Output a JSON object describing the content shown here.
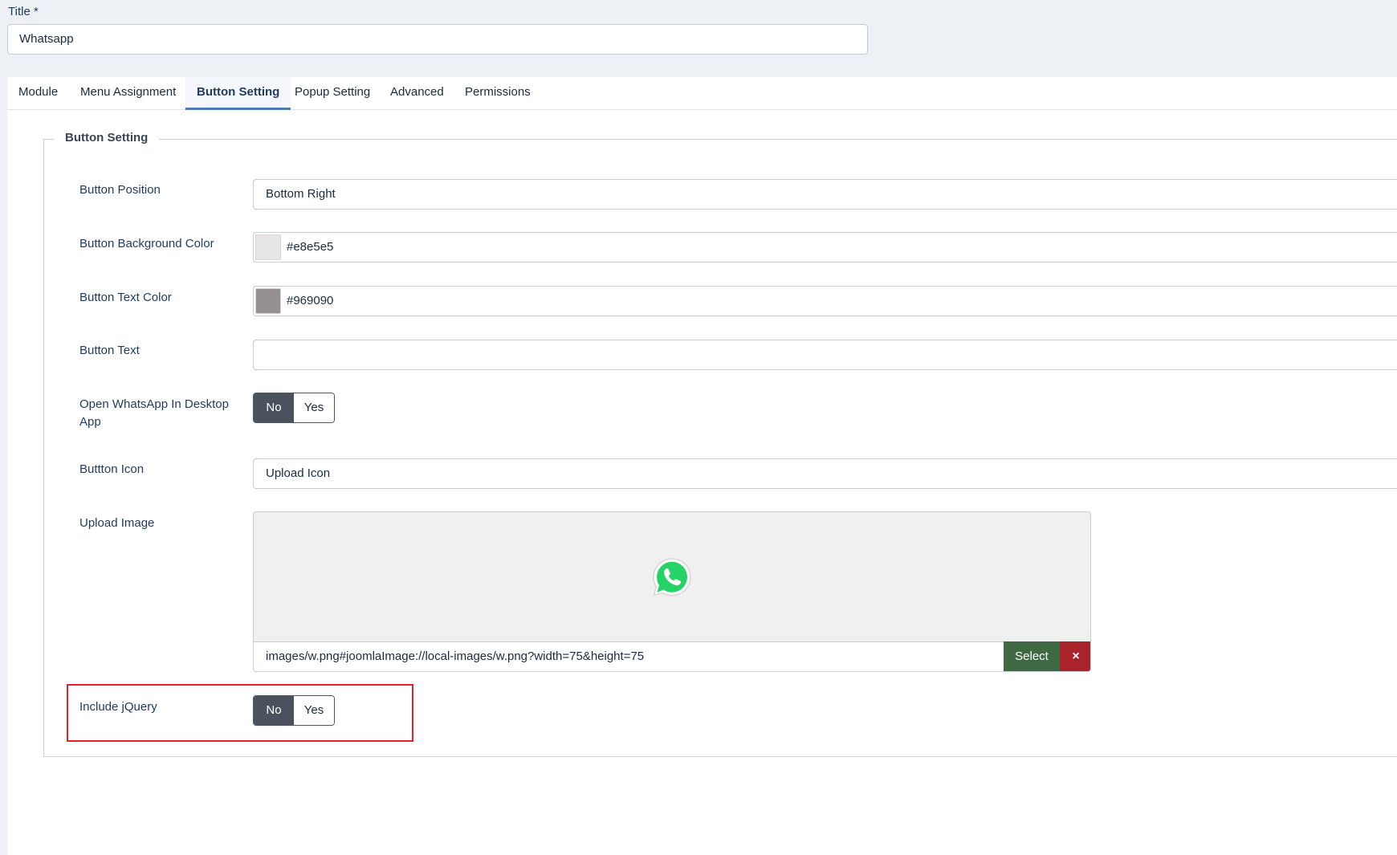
{
  "title_field": {
    "label": "Title *",
    "value": "Whatsapp"
  },
  "tabs": [
    {
      "label": "Module"
    },
    {
      "label": "Menu Assignment"
    },
    {
      "label": "Button Setting",
      "active": true
    },
    {
      "label": "Popup Setting"
    },
    {
      "label": "Advanced"
    },
    {
      "label": "Permissions"
    }
  ],
  "fieldset": {
    "legend": "Button Setting",
    "button_position": {
      "label": "Button Position",
      "value": "Bottom Right"
    },
    "bg_color": {
      "label": "Button Background Color",
      "value": "#e8e5e5",
      "swatch": "#e8e5e5"
    },
    "text_color": {
      "label": "Button Text Color",
      "value": "#969090",
      "swatch": "#969090"
    },
    "button_text": {
      "label": "Button Text",
      "value": ""
    },
    "open_desktop": {
      "label": "Open WhatsApp In Desktop App",
      "no": "No",
      "yes": "Yes",
      "selected": "No"
    },
    "button_icon": {
      "label": "Buttton Icon",
      "value": "Upload Icon"
    },
    "upload_image": {
      "label": "Upload Image",
      "path": "images/w.png#joomlaImage://local-images/w.png?width=75&height=75",
      "select_label": "Select",
      "clear_label": "×",
      "preview_icon": "whatsapp-logo-icon"
    },
    "include_jquery": {
      "label": "Include jQuery",
      "no": "No",
      "yes": "Yes",
      "selected": "No"
    }
  },
  "colors": {
    "active_tab_underline": "#4a7ab8",
    "toggle_on": "#4a525e",
    "select_button": "#3e6943",
    "clear_button": "#a8232a",
    "highlight": "#e8202a",
    "whatsapp_green": "#25d366"
  }
}
